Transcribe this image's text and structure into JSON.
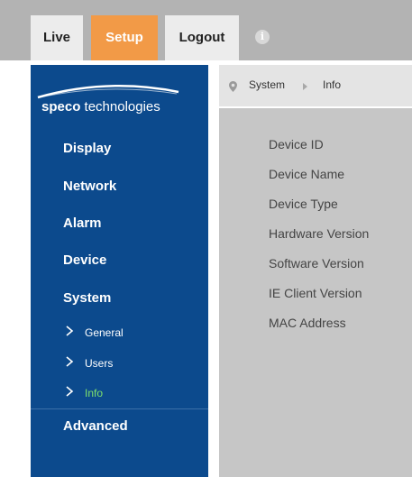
{
  "topbar": {
    "tabs": {
      "live": "Live",
      "setup": "Setup",
      "logout": "Logout"
    },
    "info_icon": "i"
  },
  "sidebar": {
    "logo": {
      "part1": "speco",
      "part2": " technologies"
    },
    "items": {
      "display": "Display",
      "network": "Network",
      "alarm": "Alarm",
      "device": "Device",
      "system": "System",
      "advanced": "Advanced"
    },
    "subitems": {
      "general": "General",
      "users": "Users",
      "info": "Info"
    },
    "active_subitem_color": "#7ee06c"
  },
  "breadcrumb": {
    "level1": "System",
    "level2": "Info"
  },
  "info_fields": {
    "device_id": "Device ID",
    "device_name": "Device Name",
    "device_type": "Device Type",
    "hardware_version": "Hardware Version",
    "software_version": "Software Version",
    "ie_client_version": "IE Client Version",
    "mac_address": "MAC Address"
  },
  "colors": {
    "accent": "#f29a47",
    "sidebar": "#0c4a8d",
    "topbar": "#b3b3b3",
    "content": "#c6c6c6"
  }
}
